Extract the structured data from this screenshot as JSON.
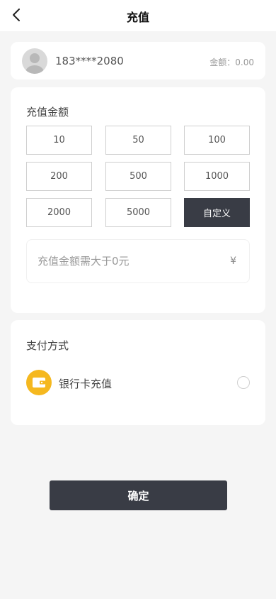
{
  "header": {
    "title": "充值",
    "back_icon": "chevron-left-icon"
  },
  "user": {
    "phone": "183****2080",
    "balance_label": "金额：",
    "balance_value": "0.00",
    "avatar_icon": "default-avatar-icon"
  },
  "amount": {
    "title": "充值金额",
    "options": [
      "10",
      "50",
      "100",
      "200",
      "500",
      "1000",
      "2000",
      "5000",
      "自定义"
    ],
    "selected": "自定义",
    "input_placeholder": "充值金额需大于0元",
    "input_value": "",
    "currency_symbol": "¥"
  },
  "payment": {
    "title": "支付方式",
    "methods": [
      {
        "label": "银行卡充值",
        "icon": "wallet-icon",
        "selected": false
      }
    ]
  },
  "colors": {
    "accent": "#393c45",
    "wallet": "#f5b81f",
    "background": "#f5f5f5"
  },
  "confirm_label": "确定"
}
